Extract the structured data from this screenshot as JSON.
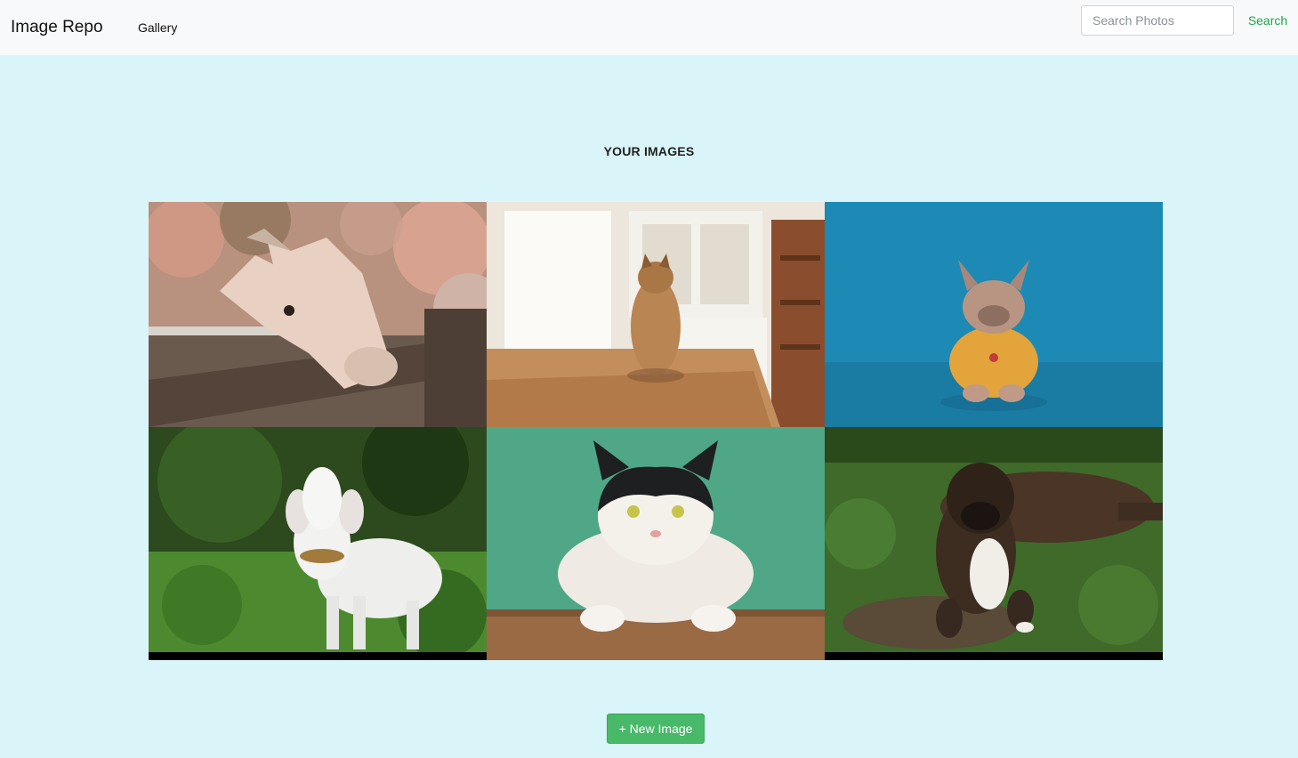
{
  "navbar": {
    "brand": "Image Repo",
    "links": [
      "Gallery"
    ],
    "search": {
      "placeholder": "Search Photos",
      "value": "",
      "button_label": "Search"
    }
  },
  "main": {
    "title": "YOUR IMAGES",
    "images": [
      {
        "subject": "goat"
      },
      {
        "subject": "cat"
      },
      {
        "subject": "dog"
      },
      {
        "subject": "goat"
      },
      {
        "subject": "cat"
      },
      {
        "subject": "dog"
      }
    ],
    "new_button_label": "+ New Image"
  },
  "colors": {
    "page_background": "#daf5f9",
    "navbar_background": "#f8f9fa",
    "accent_green": "#1ea84a",
    "button_green": "#48b869"
  }
}
